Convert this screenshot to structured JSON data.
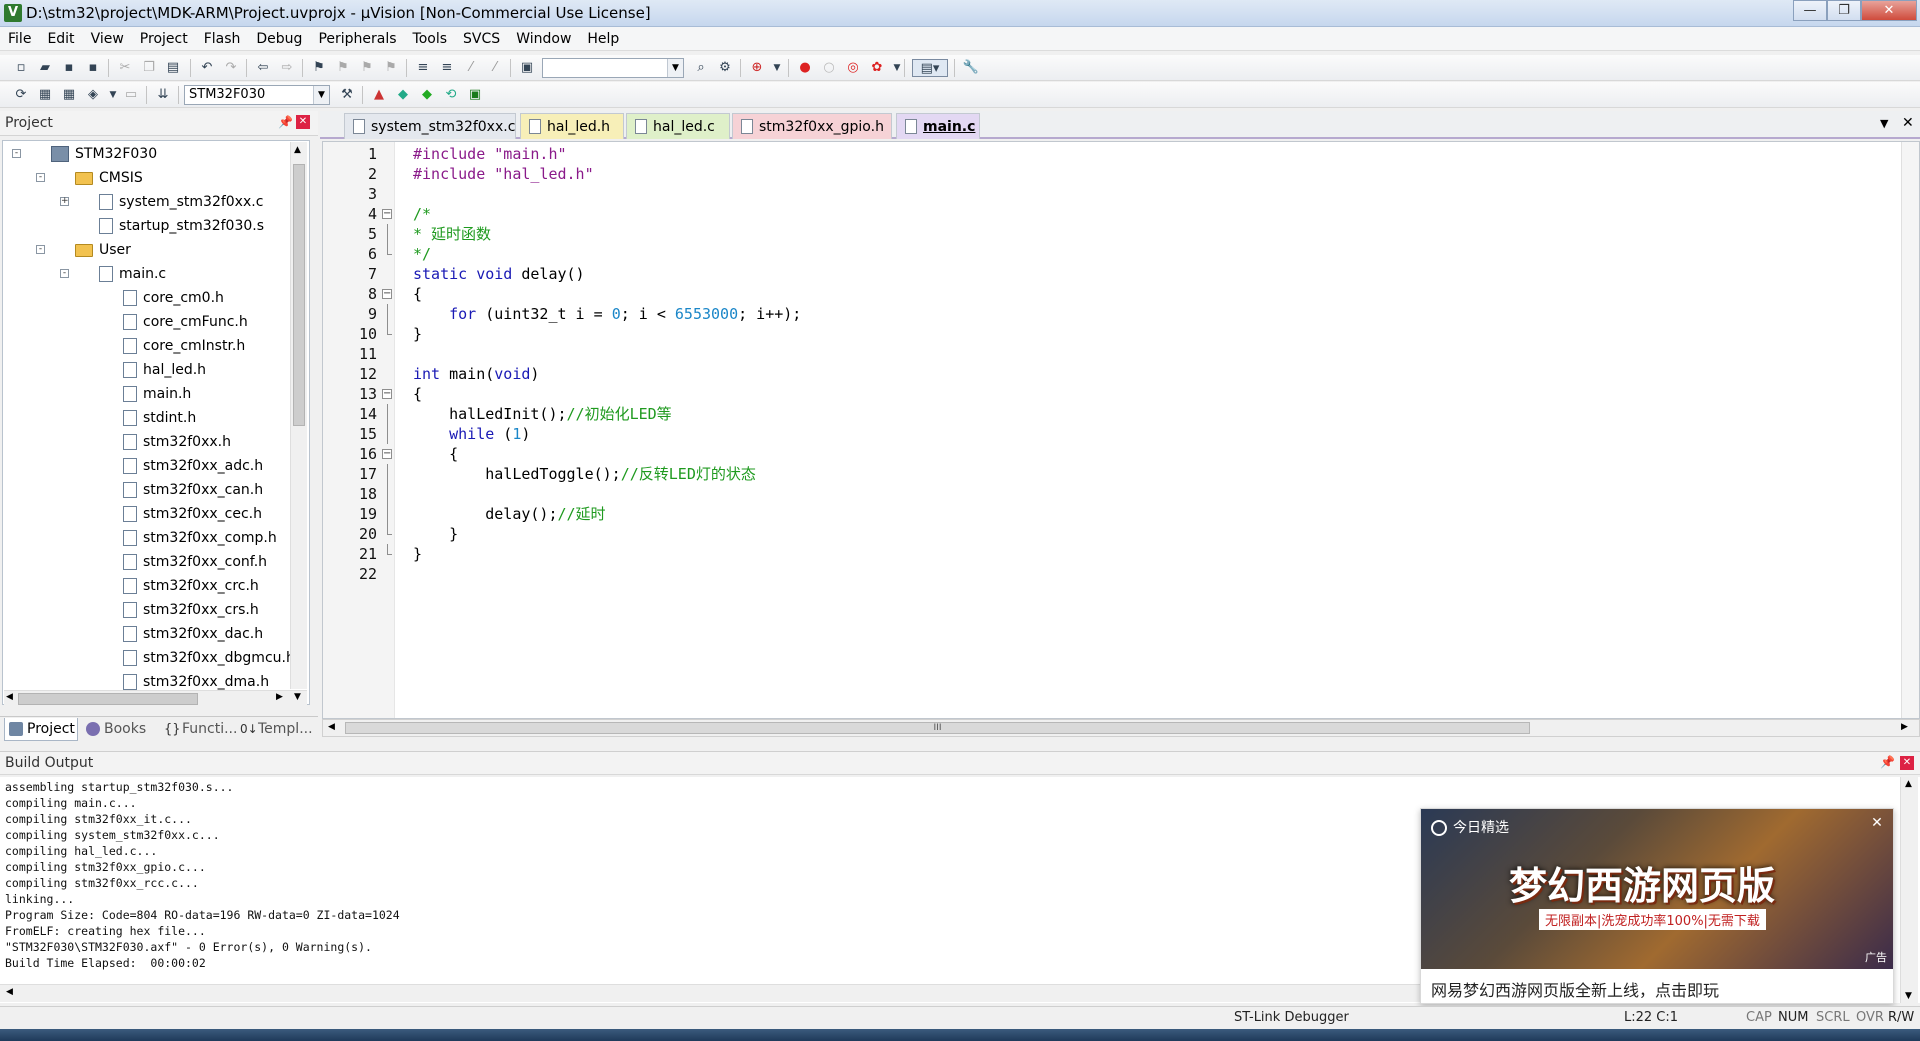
{
  "window": {
    "title": "D:\\stm32\\project\\MDK-ARM\\Project.uvprojx - µVision  [Non-Commercial Use License]",
    "app_icon": "V"
  },
  "menu": [
    "File",
    "Edit",
    "View",
    "Project",
    "Flash",
    "Debug",
    "Peripherals",
    "Tools",
    "SVCS",
    "Window",
    "Help"
  ],
  "toolbar": {
    "target": "STM32F030"
  },
  "project_panel": {
    "title": "Project",
    "tree": [
      {
        "label": "STM32F030",
        "kind": "project",
        "level": 0,
        "exp": "-"
      },
      {
        "label": "CMSIS",
        "kind": "folder",
        "level": 1,
        "exp": "-"
      },
      {
        "label": "system_stm32f0xx.c",
        "kind": "file",
        "level": 2,
        "exp": "+"
      },
      {
        "label": "startup_stm32f030.s",
        "kind": "file",
        "level": 2,
        "exp": ""
      },
      {
        "label": "User",
        "kind": "folder",
        "level": 1,
        "exp": "-"
      },
      {
        "label": "main.c",
        "kind": "file",
        "level": 2,
        "exp": "-"
      },
      {
        "label": "core_cm0.h",
        "kind": "file",
        "level": 3,
        "exp": ""
      },
      {
        "label": "core_cmFunc.h",
        "kind": "file",
        "level": 3,
        "exp": ""
      },
      {
        "label": "core_cmInstr.h",
        "kind": "file",
        "level": 3,
        "exp": ""
      },
      {
        "label": "hal_led.h",
        "kind": "file",
        "level": 3,
        "exp": ""
      },
      {
        "label": "main.h",
        "kind": "file",
        "level": 3,
        "exp": ""
      },
      {
        "label": "stdint.h",
        "kind": "file",
        "level": 3,
        "exp": ""
      },
      {
        "label": "stm32f0xx.h",
        "kind": "file",
        "level": 3,
        "exp": ""
      },
      {
        "label": "stm32f0xx_adc.h",
        "kind": "file",
        "level": 3,
        "exp": ""
      },
      {
        "label": "stm32f0xx_can.h",
        "kind": "file",
        "level": 3,
        "exp": ""
      },
      {
        "label": "stm32f0xx_cec.h",
        "kind": "file",
        "level": 3,
        "exp": ""
      },
      {
        "label": "stm32f0xx_comp.h",
        "kind": "file",
        "level": 3,
        "exp": ""
      },
      {
        "label": "stm32f0xx_conf.h",
        "kind": "file",
        "level": 3,
        "exp": ""
      },
      {
        "label": "stm32f0xx_crc.h",
        "kind": "file",
        "level": 3,
        "exp": ""
      },
      {
        "label": "stm32f0xx_crs.h",
        "kind": "file",
        "level": 3,
        "exp": ""
      },
      {
        "label": "stm32f0xx_dac.h",
        "kind": "file",
        "level": 3,
        "exp": ""
      },
      {
        "label": "stm32f0xx_dbgmcu.h",
        "kind": "file",
        "level": 3,
        "exp": ""
      },
      {
        "label": "stm32f0xx_dma.h",
        "kind": "file",
        "level": 3,
        "exp": ""
      }
    ],
    "tabs": [
      "Project",
      "Books",
      "Functi...",
      "Templ..."
    ]
  },
  "editor": {
    "tabs": [
      {
        "label": "system_stm32f0xx.c",
        "color": "#e4e8ee",
        "active": false
      },
      {
        "label": "hal_led.h",
        "color": "#f7efb8",
        "active": false
      },
      {
        "label": "hal_led.c",
        "color": "#dff0c9",
        "active": false
      },
      {
        "label": "stm32f0xx_gpio.h",
        "color": "#f6d2d6",
        "active": false
      },
      {
        "label": "main.c",
        "color": "#e3d8f3",
        "active": true
      }
    ],
    "lines": [
      [
        [
          "str",
          "#include \"main.h\""
        ]
      ],
      [
        [
          "str",
          "#include \"hal_led.h\""
        ]
      ],
      [],
      [
        [
          "cm",
          "/*"
        ]
      ],
      [
        [
          "cm",
          "* 延时函数"
        ]
      ],
      [
        [
          "cm",
          "*/"
        ]
      ],
      [
        [
          "kw",
          "static"
        ],
        [
          "t",
          " "
        ],
        [
          "kw",
          "void"
        ],
        [
          "t",
          " delay()"
        ]
      ],
      [
        [
          "t",
          "{"
        ]
      ],
      [
        [
          "t",
          "    "
        ],
        [
          "kw",
          "for"
        ],
        [
          "t",
          " (uint32_t i = "
        ],
        [
          "num",
          "0"
        ],
        [
          "t",
          "; i < "
        ],
        [
          "num",
          "6553000"
        ],
        [
          "t",
          "; i++);"
        ]
      ],
      [
        [
          "t",
          "}"
        ]
      ],
      [],
      [
        [
          "kw",
          "int"
        ],
        [
          "t",
          " main("
        ],
        [
          "kw",
          "void"
        ],
        [
          "t",
          ")"
        ]
      ],
      [
        [
          "t",
          "{"
        ]
      ],
      [
        [
          "t",
          "    halLedInit();"
        ],
        [
          "cm",
          "//初始化LED等"
        ]
      ],
      [
        [
          "t",
          "    "
        ],
        [
          "kw",
          "while"
        ],
        [
          "t",
          " ("
        ],
        [
          "num",
          "1"
        ],
        [
          "t",
          ")"
        ]
      ],
      [
        [
          "t",
          "    {"
        ]
      ],
      [
        [
          "t",
          "        halLedToggle();"
        ],
        [
          "cm",
          "//反转LED灯的状态"
        ]
      ],
      [],
      [
        [
          "t",
          "        delay();"
        ],
        [
          "cm",
          "//延时"
        ]
      ],
      [
        [
          "t",
          "    }"
        ]
      ],
      [
        [
          "t",
          "}"
        ]
      ],
      []
    ],
    "folds": {
      "4": "open",
      "5": "line",
      "6": "end",
      "8": "open",
      "9": "line",
      "10": "end",
      "13": "open",
      "14": "line",
      "15": "line",
      "16": "open",
      "17": "line",
      "18": "line",
      "19": "line",
      "20": "end",
      "21": "end"
    },
    "hscroll_grip": "III"
  },
  "build": {
    "title": "Build Output",
    "lines": [
      "assembling startup_stm32f030.s...",
      "compiling main.c...",
      "compiling stm32f0xx_it.c...",
      "compiling system_stm32f0xx.c...",
      "compiling hal_led.c...",
      "compiling stm32f0xx_gpio.c...",
      "compiling stm32f0xx_rcc.c...",
      "linking...",
      "Program Size: Code=804 RO-data=196 RW-data=0 ZI-data=1024",
      "FromELF: creating hex file...",
      "\"STM32F030\\STM32F030.axf\" - 0 Error(s), 0 Warning(s).",
      "Build Time Elapsed:  00:00:02"
    ]
  },
  "ad": {
    "header": "今日精选",
    "headline": "梦幻西游网页版",
    "subline": "无限副本|洗宠成功率100%|无需下载",
    "label": "广告",
    "caption": "网易梦幻西游网页版全新上线，点击即玩"
  },
  "status": {
    "debugger": "ST-Link Debugger",
    "position": "L:22 C:1",
    "flags": [
      "CAP",
      "NUM",
      "SCRL",
      "OVR",
      "R/W"
    ]
  }
}
